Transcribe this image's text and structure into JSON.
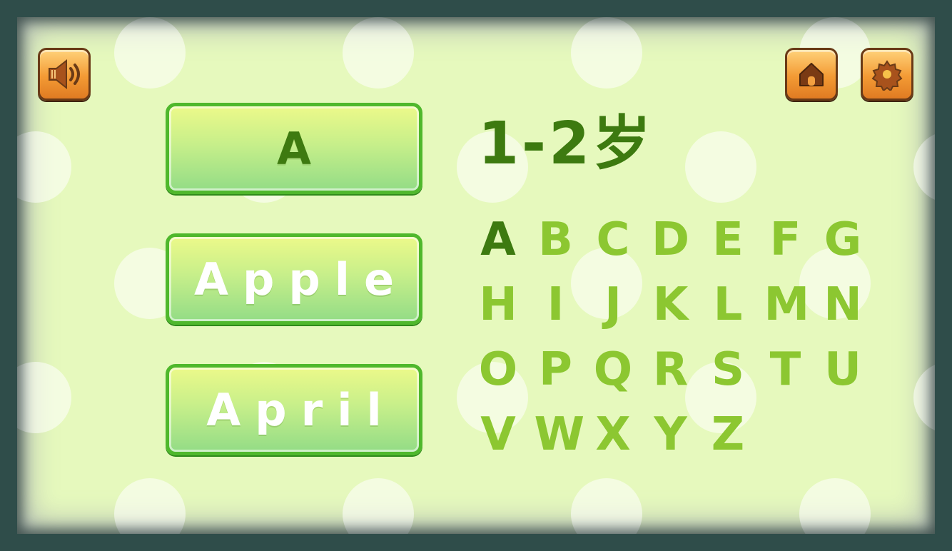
{
  "header": {
    "sound_icon": "speaker-icon",
    "home_icon": "home-icon",
    "settings_icon": "gear-icon"
  },
  "words": {
    "letter": "A",
    "word1": "Apple",
    "word2": "April"
  },
  "age_label": "1-2岁",
  "alphabet": {
    "selected": "A",
    "letters": [
      "A",
      "B",
      "C",
      "D",
      "E",
      "F",
      "G",
      "H",
      "I",
      "J",
      "K",
      "L",
      "M",
      "N",
      "O",
      "P",
      "Q",
      "R",
      "S",
      "T",
      "U",
      "V",
      "W",
      "X",
      "Y",
      "Z"
    ]
  },
  "colors": {
    "background": "#e6f9bd",
    "active_letter": "#3d7a10",
    "inactive_letter": "#8cc731",
    "button_border": "#4fb82c",
    "icon_button": "#f39a34"
  }
}
